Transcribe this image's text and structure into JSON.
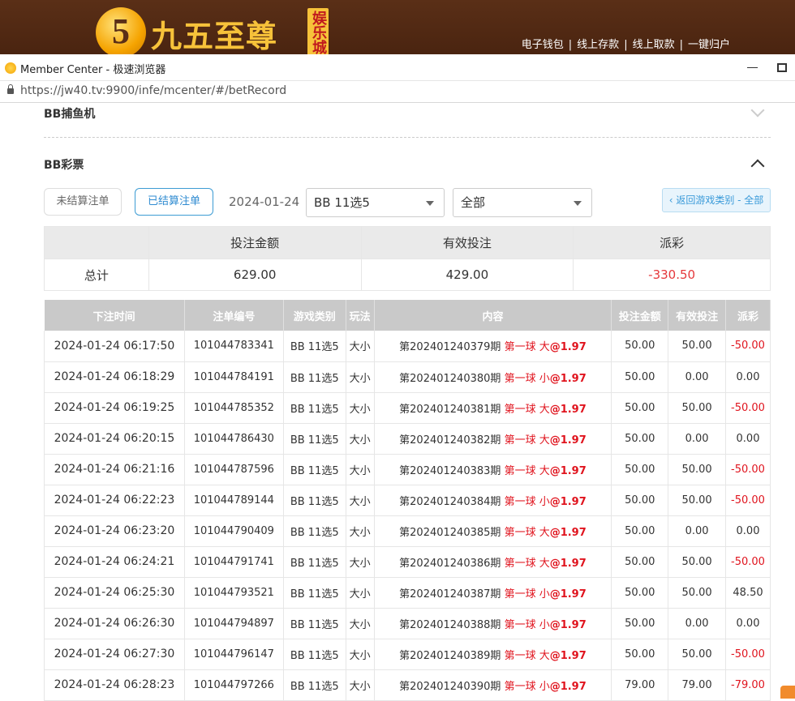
{
  "banner": {
    "logo_numeral": "5",
    "logo_text": "九五至尊",
    "logo_badge": "娱乐城",
    "links": [
      "电子钱包",
      "线上存款",
      "线上取款",
      "一键归户"
    ],
    "separator": "|"
  },
  "window": {
    "title": "Member Center - 极速浏览器",
    "url": "https://jw40.tv:9900/infe/mcenter/#/betRecord"
  },
  "sections": {
    "fishing": "BB捕鱼机",
    "lottery": "BB彩票"
  },
  "filters": {
    "unsettled": "未结算注单",
    "settled": "已结算注单",
    "date": "2024-01-24",
    "game": "BB 11选5",
    "scope": "全部",
    "back": "‹ 返回游戏类别 - 全部"
  },
  "summary": {
    "headers": [
      "投注金额",
      "有效投注",
      "派彩"
    ],
    "row_label": "总计",
    "bet": "629.00",
    "valid": "429.00",
    "payout": "-330.50"
  },
  "table": {
    "headers": [
      "下注时间",
      "注单编号",
      "游戏类别",
      "玩法",
      "内容",
      "投注金额",
      "有效投注",
      "派彩"
    ],
    "rows": [
      {
        "time": "2024-01-24 06:17:50",
        "id": "101044783341",
        "game": "BB 11选5",
        "play": "大小",
        "period": "第202401240379期",
        "pick": "第一球 大",
        "odds": "@1.97",
        "bet": "50.00",
        "valid": "50.00",
        "payout": "-50.00"
      },
      {
        "time": "2024-01-24 06:18:29",
        "id": "101044784191",
        "game": "BB 11选5",
        "play": "大小",
        "period": "第202401240380期",
        "pick": "第一球 小",
        "odds": "@1.97",
        "bet": "50.00",
        "valid": "0.00",
        "payout": "0.00"
      },
      {
        "time": "2024-01-24 06:19:25",
        "id": "101044785352",
        "game": "BB 11选5",
        "play": "大小",
        "period": "第202401240381期",
        "pick": "第一球 大",
        "odds": "@1.97",
        "bet": "50.00",
        "valid": "50.00",
        "payout": "-50.00"
      },
      {
        "time": "2024-01-24 06:20:15",
        "id": "101044786430",
        "game": "BB 11选5",
        "play": "大小",
        "period": "第202401240382期",
        "pick": "第一球 大",
        "odds": "@1.97",
        "bet": "50.00",
        "valid": "0.00",
        "payout": "0.00"
      },
      {
        "time": "2024-01-24 06:21:16",
        "id": "101044787596",
        "game": "BB 11选5",
        "play": "大小",
        "period": "第202401240383期",
        "pick": "第一球 大",
        "odds": "@1.97",
        "bet": "50.00",
        "valid": "50.00",
        "payout": "-50.00"
      },
      {
        "time": "2024-01-24 06:22:23",
        "id": "101044789144",
        "game": "BB 11选5",
        "play": "大小",
        "period": "第202401240384期",
        "pick": "第一球 小",
        "odds": "@1.97",
        "bet": "50.00",
        "valid": "50.00",
        "payout": "-50.00"
      },
      {
        "time": "2024-01-24 06:23:20",
        "id": "101044790409",
        "game": "BB 11选5",
        "play": "大小",
        "period": "第202401240385期",
        "pick": "第一球 大",
        "odds": "@1.97",
        "bet": "50.00",
        "valid": "0.00",
        "payout": "0.00"
      },
      {
        "time": "2024-01-24 06:24:21",
        "id": "101044791741",
        "game": "BB 11选5",
        "play": "大小",
        "period": "第202401240386期",
        "pick": "第一球 大",
        "odds": "@1.97",
        "bet": "50.00",
        "valid": "50.00",
        "payout": "-50.00"
      },
      {
        "time": "2024-01-24 06:25:30",
        "id": "101044793521",
        "game": "BB 11选5",
        "play": "大小",
        "period": "第202401240387期",
        "pick": "第一球 小",
        "odds": "@1.97",
        "bet": "50.00",
        "valid": "50.00",
        "payout": "48.50"
      },
      {
        "time": "2024-01-24 06:26:30",
        "id": "101044794897",
        "game": "BB 11选5",
        "play": "大小",
        "period": "第202401240388期",
        "pick": "第一球 小",
        "odds": "@1.97",
        "bet": "50.00",
        "valid": "0.00",
        "payout": "0.00"
      },
      {
        "time": "2024-01-24 06:27:30",
        "id": "101044796147",
        "game": "BB 11选5",
        "play": "大小",
        "period": "第202401240389期",
        "pick": "第一球 大",
        "odds": "@1.97",
        "bet": "50.00",
        "valid": "50.00",
        "payout": "-50.00"
      },
      {
        "time": "2024-01-24 06:28:23",
        "id": "101044797266",
        "game": "BB 11选5",
        "play": "大小",
        "period": "第202401240390期",
        "pick": "第一球 小",
        "odds": "@1.97",
        "bet": "79.00",
        "valid": "79.00",
        "payout": "-79.00"
      }
    ]
  },
  "colors": {
    "negative": "#e5383b",
    "accent": "#2f8bd1",
    "banner": "#4a2410"
  }
}
